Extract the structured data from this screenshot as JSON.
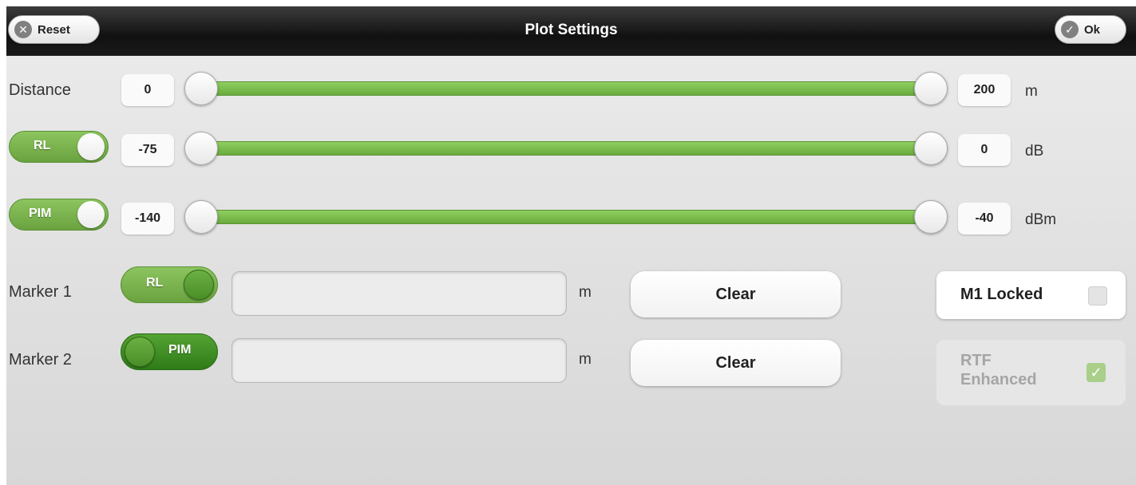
{
  "header": {
    "title": "Plot Settings",
    "reset_label": "Reset",
    "ok_label": "Ok",
    "reset_icon": "x-circle-icon",
    "ok_icon": "check-circle-icon"
  },
  "sliders": [
    {
      "label": "Distance",
      "min": "0",
      "max": "200",
      "unit": "m"
    },
    {
      "toggle_label": "RL",
      "toggle_on": true,
      "min": "-75",
      "max": "0",
      "unit": "dB"
    },
    {
      "toggle_label": "PIM",
      "toggle_on": true,
      "min": "-140",
      "max": "-40",
      "unit": "dBm"
    }
  ],
  "markers": [
    {
      "label": "Marker 1",
      "toggle_label": "RL",
      "value": "",
      "unit": "m",
      "clear_label": "Clear"
    },
    {
      "label": "Marker 2",
      "toggle_label": "PIM",
      "value": "",
      "unit": "m",
      "clear_label": "Clear"
    }
  ],
  "options": {
    "m1_locked_label": "M1 Locked",
    "m1_locked_checked": false,
    "rtf_label_line1": "RTF",
    "rtf_label_line2": "Enhanced",
    "rtf_checked": true,
    "rtf_disabled": true
  },
  "colors": {
    "accent_green": "#6aab3e",
    "header_bg": "#111111"
  }
}
